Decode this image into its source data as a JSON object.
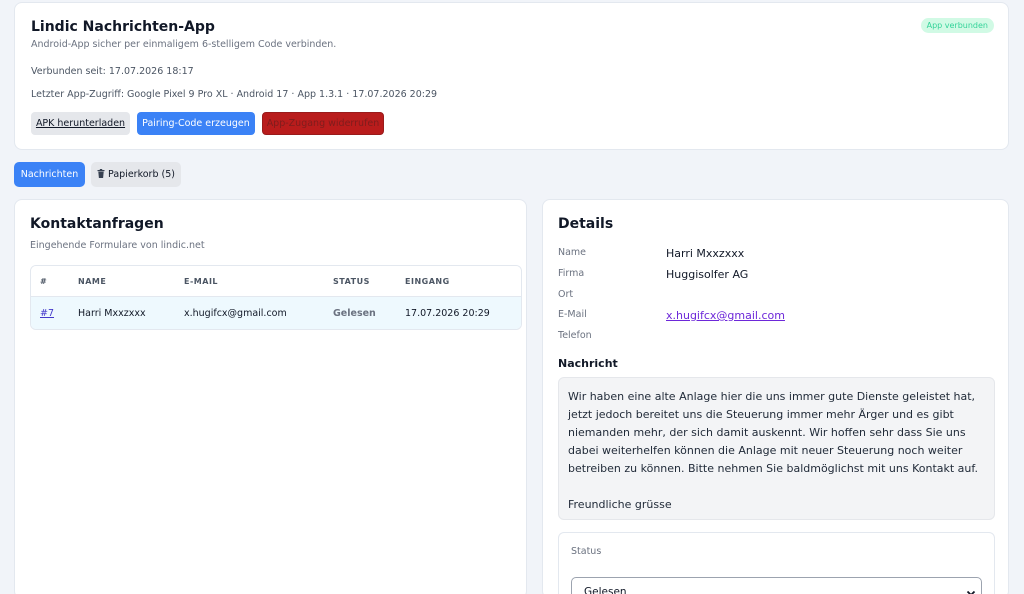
{
  "app": {
    "title": "Lindic Nachrichten-App",
    "subtitle": "Android-App sicher per einmaligem 6-stelligem Code verbinden.",
    "connected_since": "Verbunden seit: 17.07.2026 18:17",
    "last_access": "Letzter App-Zugriff: Google Pixel 9 Pro XL · Android 17 · App 1.3.1 · 17.07.2026 20:29",
    "status_badge": "App verbunden",
    "buttons": {
      "apk": "APK herunterladen",
      "pairing": "Pairing-Code erzeugen",
      "revoke": "App-Zugang widerrufen"
    }
  },
  "tabs": {
    "messages": "Nachrichten",
    "trash": "Papierkorb (5)",
    "trash_icon": "trash-icon"
  },
  "requests": {
    "title": "Kontaktanfragen",
    "subtitle": "Eingehende Formulare von lindic.net",
    "columns": [
      "#",
      "NAME",
      "E-MAIL",
      "STATUS",
      "EINGANG"
    ],
    "rows": [
      {
        "id": "#7",
        "name": "Harri Mxxzxxx",
        "email": "x.hugifcx@gmail.com",
        "status": "Gelesen",
        "received": "17.07.2026 20:29"
      }
    ]
  },
  "details": {
    "title": "Details",
    "labels": {
      "name": "Name",
      "company": "Firma",
      "city": "Ort",
      "email": "E-Mail",
      "phone": "Telefon"
    },
    "values": {
      "name": "Harri Mxxzxxx",
      "company": "Huggisolfer AG",
      "city": "",
      "email": "x.hugifcx@gmail.com",
      "phone": ""
    },
    "message_heading": "Nachricht",
    "message": "Wir haben eine alte Anlage hier die uns immer gute Dienste geleistet hat, jetzt jedoch bereitet uns die Steuerung immer mehr Ärger und es gibt niemanden mehr, der sich damit auskennt. Wir hoffen sehr dass Sie uns dabei weiterhelfen können die Anlage mit neuer Steuerung noch weiter betreiben zu können. Bitte nehmen Sie baldmöglichst mit uns Kontakt auf.\n\nFreundliche grüsse",
    "status_label": "Status",
    "status_value": "Gelesen"
  },
  "colors": {
    "primary": "#3b82f6",
    "danger": "#b91c1c",
    "success_bg": "#d1fae5",
    "row_highlight": "#eef9fe"
  }
}
